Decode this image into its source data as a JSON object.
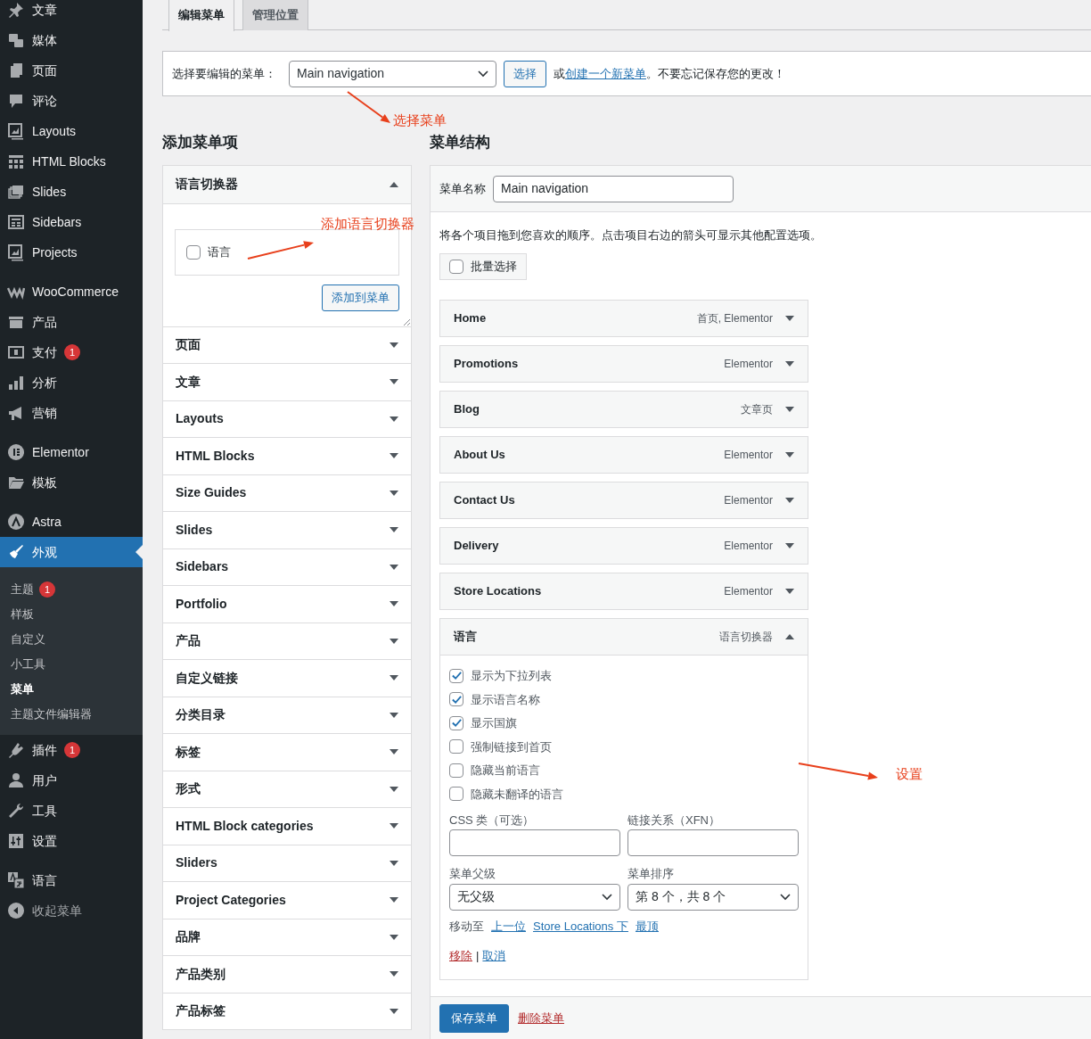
{
  "sidebar": {
    "groups": [
      [
        {
          "label": "文章",
          "selected": false
        },
        {
          "label": "媒体",
          "selected": false
        },
        {
          "label": "页面",
          "selected": false
        },
        {
          "label": "评论",
          "selected": false
        },
        {
          "label": "Layouts",
          "selected": false
        },
        {
          "label": "HTML Blocks",
          "selected": false
        },
        {
          "label": "Slides",
          "selected": false
        },
        {
          "label": "Sidebars",
          "selected": false
        },
        {
          "label": "Projects",
          "selected": false
        }
      ],
      [
        {
          "label": "WooCommerce",
          "selected": false
        },
        {
          "label": "产品",
          "selected": false
        },
        {
          "label": "支付",
          "badge": "1",
          "selected": false
        },
        {
          "label": "分析",
          "selected": false
        },
        {
          "label": "营销",
          "selected": false
        }
      ],
      [
        {
          "label": "Elementor",
          "selected": false
        },
        {
          "label": "模板",
          "selected": false
        }
      ],
      [
        {
          "label": "Astra",
          "selected": false
        },
        {
          "label": "外观",
          "selected": true,
          "children": [
            {
              "label": "主题",
              "badge": "1",
              "selected": false
            },
            {
              "label": "样板",
              "selected": false
            },
            {
              "label": "自定义",
              "selected": false
            },
            {
              "label": "小工具",
              "selected": false
            },
            {
              "label": "菜单",
              "selected": true
            },
            {
              "label": "主题文件编辑器",
              "selected": false
            }
          ]
        },
        {
          "label": "插件",
          "badge": "1",
          "selected": false
        },
        {
          "label": "用户",
          "selected": false
        },
        {
          "label": "工具",
          "selected": false
        },
        {
          "label": "设置",
          "selected": false
        }
      ],
      [
        {
          "label": "语言",
          "selected": false
        }
      ]
    ],
    "collapse": "收起菜单"
  },
  "tabs": [
    {
      "label": "编辑菜单",
      "selected": true
    },
    {
      "label": "管理位置",
      "selected": false
    }
  ],
  "menu_select": {
    "label": "选择要编辑的菜单：",
    "value": "Main navigation",
    "button": "选择",
    "note_prefix": "或",
    "note_link": "创建一个新菜单",
    "note_suffix": "。不要忘记保存您的更改！"
  },
  "add_items": {
    "heading": "添加菜单项",
    "panels": [
      {
        "title": "语言切换器",
        "expanded": true,
        "options": [
          {
            "label": "语言",
            "checked": false
          }
        ],
        "button": "添加到菜单"
      },
      {
        "title": "页面",
        "expanded": false
      },
      {
        "title": "文章",
        "expanded": false
      },
      {
        "title": "Layouts",
        "expanded": false
      },
      {
        "title": "HTML Blocks",
        "expanded": false
      },
      {
        "title": "Size Guides",
        "expanded": false
      },
      {
        "title": "Slides",
        "expanded": false
      },
      {
        "title": "Sidebars",
        "expanded": false
      },
      {
        "title": "Portfolio",
        "expanded": false
      },
      {
        "title": "产品",
        "expanded": false
      },
      {
        "title": "自定义链接",
        "expanded": false
      },
      {
        "title": "分类目录",
        "expanded": false
      },
      {
        "title": "标签",
        "expanded": false
      },
      {
        "title": "形式",
        "expanded": false
      },
      {
        "title": "HTML Block categories",
        "expanded": false
      },
      {
        "title": "Sliders",
        "expanded": false
      },
      {
        "title": "Project Categories",
        "expanded": false
      },
      {
        "title": "品牌",
        "expanded": false
      },
      {
        "title": "产品类别",
        "expanded": false
      },
      {
        "title": "产品标签",
        "expanded": false
      }
    ]
  },
  "structure": {
    "heading": "菜单结构",
    "name_label": "菜单名称",
    "name_value": "Main navigation",
    "instructions": "将各个项目拖到您喜欢的顺序。点击项目右边的箭头可显示其他配置选项。",
    "bulk_select": {
      "label": "批量选择",
      "checked": false
    },
    "items": [
      {
        "title": "Home",
        "type": "首页, Elementor",
        "expanded": false
      },
      {
        "title": "Promotions",
        "type": "Elementor",
        "expanded": false
      },
      {
        "title": "Blog",
        "type": "文章页",
        "expanded": false
      },
      {
        "title": "About Us",
        "type": "Elementor",
        "expanded": false
      },
      {
        "title": "Contact Us",
        "type": "Elementor",
        "expanded": false
      },
      {
        "title": "Delivery",
        "type": "Elementor",
        "expanded": false
      },
      {
        "title": "Store Locations",
        "type": "Elementor",
        "expanded": false
      },
      {
        "title": "语言",
        "type": "语言切换器",
        "expanded": true,
        "settings": {
          "options": [
            {
              "label": "显示为下拉列表",
              "checked": true
            },
            {
              "label": "显示语言名称",
              "checked": true
            },
            {
              "label": "显示国旗",
              "checked": true
            },
            {
              "label": "强制链接到首页",
              "checked": false
            },
            {
              "label": "隐藏当前语言",
              "checked": false
            },
            {
              "label": "隐藏未翻译的语言",
              "checked": false
            }
          ],
          "css_label": "CSS 类（可选）",
          "xfn_label": "链接关系（XFN）",
          "parent_label": "菜单父级",
          "parent_value": "无父级",
          "order_label": "菜单排序",
          "order_value": "第 8 个，共 8 个",
          "move_label": "移动至",
          "move_links": [
            "上一位",
            "Store Locations 下",
            "最顶"
          ],
          "remove": "移除",
          "separator": "|",
          "cancel": "取消"
        }
      }
    ]
  },
  "footer": {
    "save": "保存菜单",
    "delete": "删除菜单"
  },
  "annotations": [
    {
      "text": "选择菜单"
    },
    {
      "text": "添加语言切换器"
    },
    {
      "text": "设置"
    }
  ]
}
